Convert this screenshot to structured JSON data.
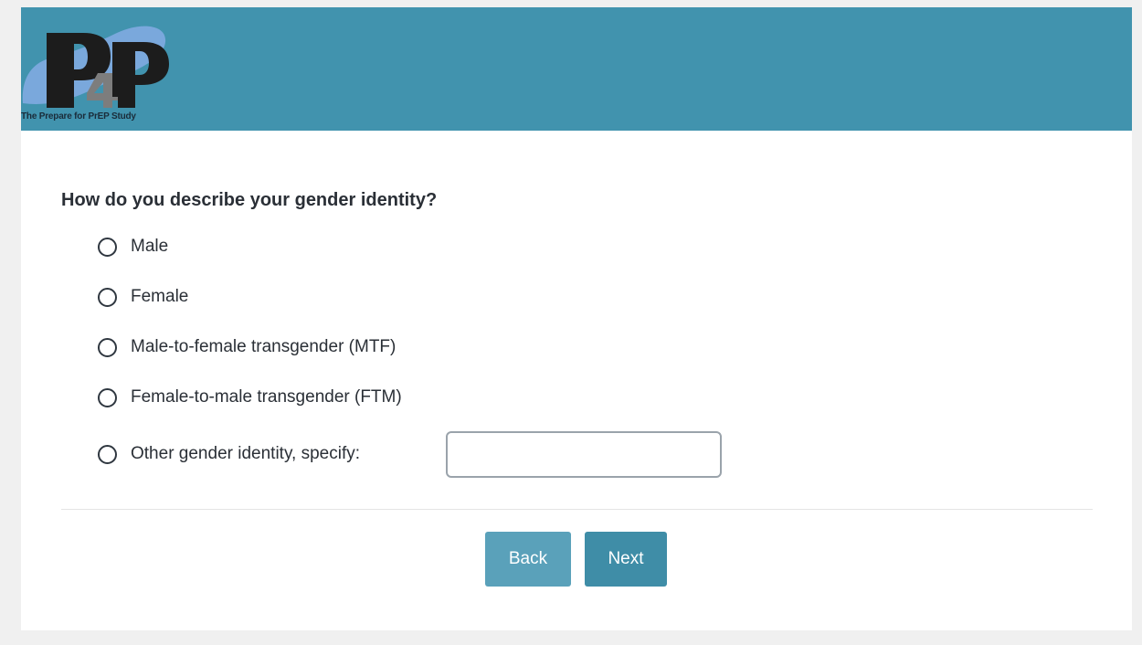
{
  "header": {
    "logo_text": "P4P",
    "logo_caption": "The Prepare for PrEP Study",
    "background_color": "#4193ae"
  },
  "question": {
    "text": "How do you describe your gender identity?",
    "options": [
      {
        "label": "Male",
        "selected": false
      },
      {
        "label": "Female",
        "selected": false
      },
      {
        "label": "Male-to-female transgender (MTF)",
        "selected": false
      },
      {
        "label": "Female-to-male transgender (FTM)",
        "selected": false
      },
      {
        "label": "Other gender identity, specify:",
        "selected": false
      }
    ],
    "other_input_value": ""
  },
  "navigation": {
    "back_label": "Back",
    "next_label": "Next",
    "back_color": "#5aa1ba",
    "next_color": "#3f8da7"
  }
}
